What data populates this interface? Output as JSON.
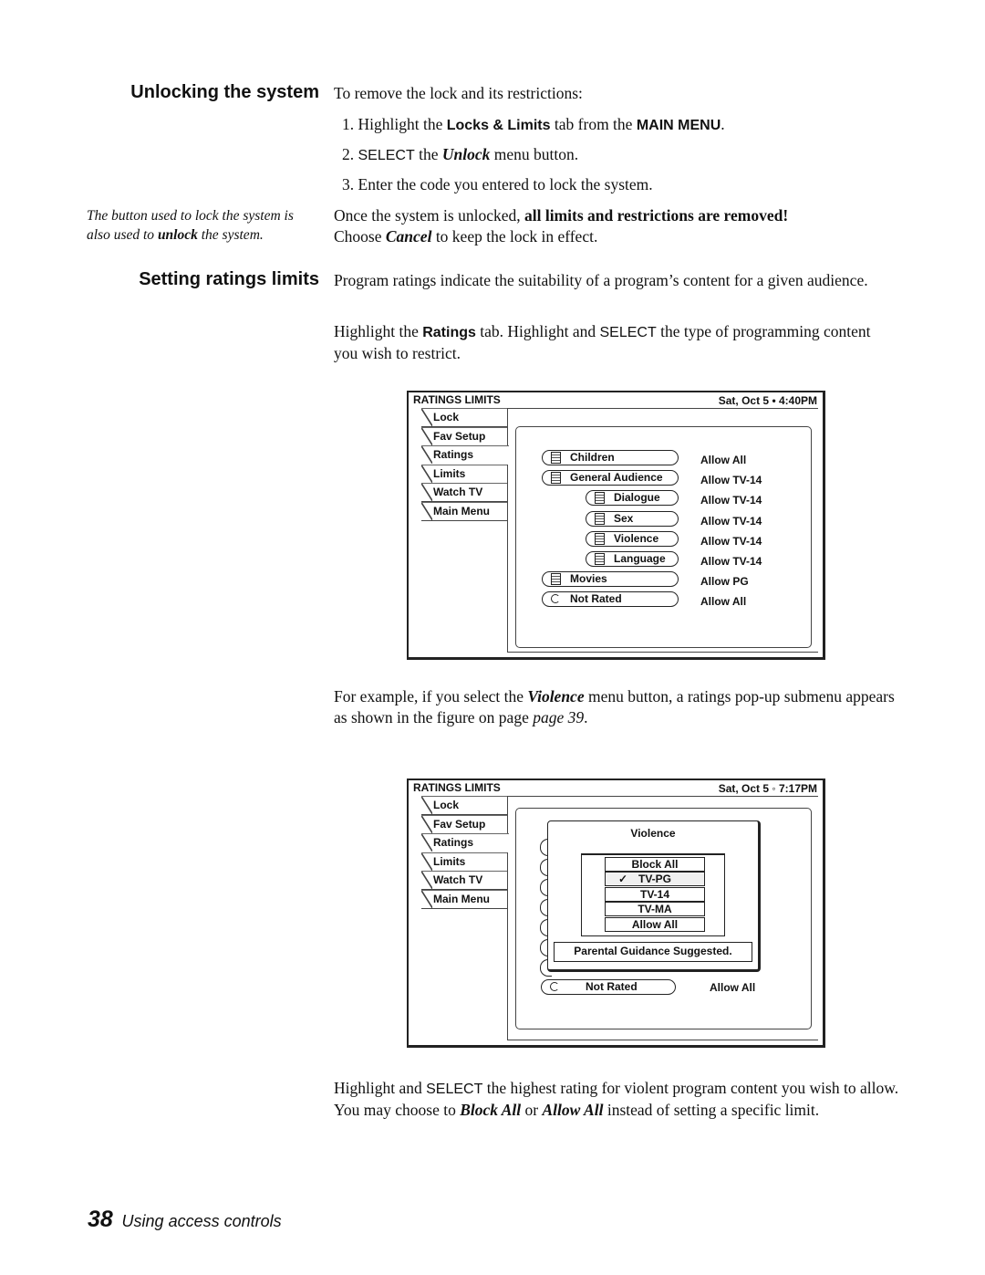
{
  "section1": {
    "heading": "Unlocking the system",
    "intro": "To remove the lock and its restrictions:",
    "steps": [
      {
        "num": "1.",
        "pre": "Highlight the ",
        "b1": "Locks & Limits",
        "mid": " tab from the ",
        "b2": "MAIN MENU",
        "post": "."
      },
      {
        "num": "2.",
        "pre": "SELECT",
        "mid": " the ",
        "em": "Unlock",
        "post": " menu button."
      },
      {
        "num": "3.",
        "text": "Enter the code you entered to lock the system."
      }
    ],
    "note_a": "The button used to lock the system is also used to ",
    "note_b": "unlock",
    "note_c": " the system.",
    "p1a": "Once the system is unlocked, ",
    "p1b": "all limits and restrictions are removed!",
    "p2a": "Choose ",
    "p2b": "Cancel",
    "p2c": " to keep the lock in effect."
  },
  "section2": {
    "heading": "Setting ratings limits",
    "p1": "Program ratings indicate the suitability of a program’s content for a given audience.",
    "p2a": "Highlight the ",
    "p2b": "Ratings",
    "p2c": " tab. Highlight and ",
    "p2d": "SELECT",
    "p2e": " the type of programming content you wish to restrict.",
    "p3a": "For example, if you select the ",
    "p3b": "Violence",
    "p3c": " menu button, a ratings pop-up submenu appears as shown in the figure on page ",
    "p3d": "page 39",
    ".": ".",
    "p3e": ".",
    "p4a": "Highlight and ",
    "p4b": "SELECT",
    "p4c": " the highest rating for violent program content you wish to allow. You may choose to ",
    "p4d": "Block All",
    "p4e": " or ",
    "p4f": "Allow All",
    "p4g": " instead of setting a specific limit."
  },
  "tabs": [
    "Lock",
    "Fav Setup",
    "Ratings",
    "Limits",
    "Watch TV",
    "Main Menu"
  ],
  "figure1": {
    "title": "RATINGS LIMITS",
    "clock": "Sat, Oct 5 • 4:40PM",
    "rows": [
      {
        "label": "Children",
        "value": "Allow All",
        "sub": false,
        "icon": "list-icon"
      },
      {
        "label": "General Audience",
        "value": "Allow TV-14",
        "sub": false,
        "icon": "list-icon"
      },
      {
        "label": "Dialogue",
        "value": "Allow TV-14",
        "sub": true,
        "icon": "list-icon"
      },
      {
        "label": "Sex",
        "value": "Allow TV-14",
        "sub": true,
        "icon": "list-icon"
      },
      {
        "label": "Violence",
        "value": "Allow TV-14",
        "sub": true,
        "icon": "list-icon"
      },
      {
        "label": "Language",
        "value": "Allow TV-14",
        "sub": true,
        "icon": "list-icon"
      },
      {
        "label": "Movies",
        "value": "Allow PG",
        "sub": false,
        "icon": "list-icon"
      },
      {
        "label": "Not Rated",
        "value": "Allow All",
        "sub": false,
        "icon": "refresh-icon"
      }
    ]
  },
  "figure2": {
    "title": "RATINGS LIMITS",
    "clock": "Sat, Oct 5 ◦ 7:17PM",
    "popup_title": "Violence",
    "options": [
      "Block All",
      "TV-PG",
      "TV-14",
      "TV-MA",
      "Allow All"
    ],
    "checked": "TV-PG",
    "description": "Parental Guidance Suggested.",
    "row_label": "Not Rated",
    "row_value": "Allow All"
  },
  "footer": {
    "page_number": "38",
    "section": "Using access controls"
  }
}
